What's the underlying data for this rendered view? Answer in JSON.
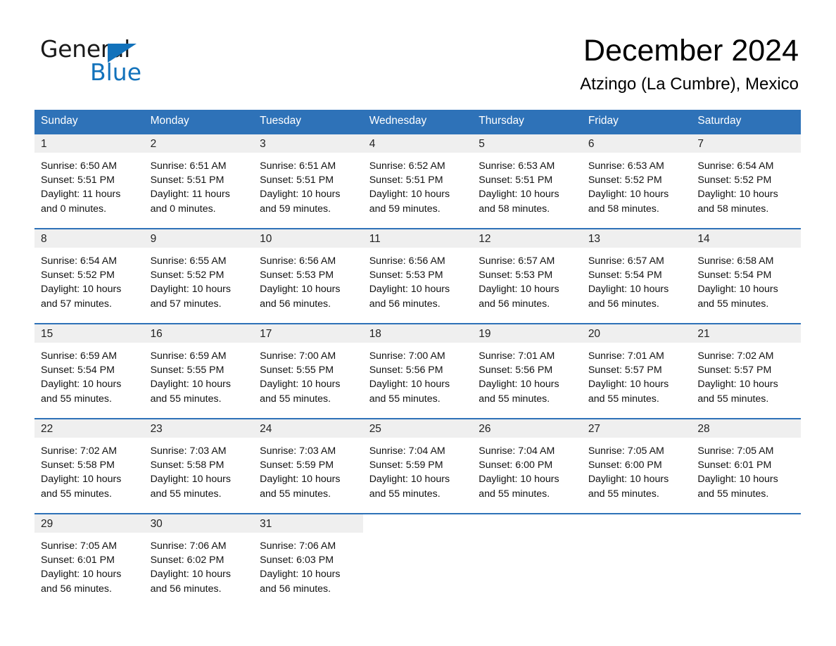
{
  "logo": {
    "primary": "General",
    "secondary": "Blue",
    "triangle_color": "#1272bb"
  },
  "header": {
    "title": "December 2024",
    "subtitle": "Atzingo (La Cumbre), Mexico"
  },
  "theme": {
    "header_blue": "#2E72B8",
    "daynum_band": "#EFEFEF",
    "text": "#000000"
  },
  "weekdays": [
    "Sunday",
    "Monday",
    "Tuesday",
    "Wednesday",
    "Thursday",
    "Friday",
    "Saturday"
  ],
  "weeks": [
    [
      {
        "day": "1",
        "sunrise": "Sunrise: 6:50 AM",
        "sunset": "Sunset: 5:51 PM",
        "daylight": "Daylight: 11 hours and 0 minutes."
      },
      {
        "day": "2",
        "sunrise": "Sunrise: 6:51 AM",
        "sunset": "Sunset: 5:51 PM",
        "daylight": "Daylight: 11 hours and 0 minutes."
      },
      {
        "day": "3",
        "sunrise": "Sunrise: 6:51 AM",
        "sunset": "Sunset: 5:51 PM",
        "daylight": "Daylight: 10 hours and 59 minutes."
      },
      {
        "day": "4",
        "sunrise": "Sunrise: 6:52 AM",
        "sunset": "Sunset: 5:51 PM",
        "daylight": "Daylight: 10 hours and 59 minutes."
      },
      {
        "day": "5",
        "sunrise": "Sunrise: 6:53 AM",
        "sunset": "Sunset: 5:51 PM",
        "daylight": "Daylight: 10 hours and 58 minutes."
      },
      {
        "day": "6",
        "sunrise": "Sunrise: 6:53 AM",
        "sunset": "Sunset: 5:52 PM",
        "daylight": "Daylight: 10 hours and 58 minutes."
      },
      {
        "day": "7",
        "sunrise": "Sunrise: 6:54 AM",
        "sunset": "Sunset: 5:52 PM",
        "daylight": "Daylight: 10 hours and 58 minutes."
      }
    ],
    [
      {
        "day": "8",
        "sunrise": "Sunrise: 6:54 AM",
        "sunset": "Sunset: 5:52 PM",
        "daylight": "Daylight: 10 hours and 57 minutes."
      },
      {
        "day": "9",
        "sunrise": "Sunrise: 6:55 AM",
        "sunset": "Sunset: 5:52 PM",
        "daylight": "Daylight: 10 hours and 57 minutes."
      },
      {
        "day": "10",
        "sunrise": "Sunrise: 6:56 AM",
        "sunset": "Sunset: 5:53 PM",
        "daylight": "Daylight: 10 hours and 56 minutes."
      },
      {
        "day": "11",
        "sunrise": "Sunrise: 6:56 AM",
        "sunset": "Sunset: 5:53 PM",
        "daylight": "Daylight: 10 hours and 56 minutes."
      },
      {
        "day": "12",
        "sunrise": "Sunrise: 6:57 AM",
        "sunset": "Sunset: 5:53 PM",
        "daylight": "Daylight: 10 hours and 56 minutes."
      },
      {
        "day": "13",
        "sunrise": "Sunrise: 6:57 AM",
        "sunset": "Sunset: 5:54 PM",
        "daylight": "Daylight: 10 hours and 56 minutes."
      },
      {
        "day": "14",
        "sunrise": "Sunrise: 6:58 AM",
        "sunset": "Sunset: 5:54 PM",
        "daylight": "Daylight: 10 hours and 55 minutes."
      }
    ],
    [
      {
        "day": "15",
        "sunrise": "Sunrise: 6:59 AM",
        "sunset": "Sunset: 5:54 PM",
        "daylight": "Daylight: 10 hours and 55 minutes."
      },
      {
        "day": "16",
        "sunrise": "Sunrise: 6:59 AM",
        "sunset": "Sunset: 5:55 PM",
        "daylight": "Daylight: 10 hours and 55 minutes."
      },
      {
        "day": "17",
        "sunrise": "Sunrise: 7:00 AM",
        "sunset": "Sunset: 5:55 PM",
        "daylight": "Daylight: 10 hours and 55 minutes."
      },
      {
        "day": "18",
        "sunrise": "Sunrise: 7:00 AM",
        "sunset": "Sunset: 5:56 PM",
        "daylight": "Daylight: 10 hours and 55 minutes."
      },
      {
        "day": "19",
        "sunrise": "Sunrise: 7:01 AM",
        "sunset": "Sunset: 5:56 PM",
        "daylight": "Daylight: 10 hours and 55 minutes."
      },
      {
        "day": "20",
        "sunrise": "Sunrise: 7:01 AM",
        "sunset": "Sunset: 5:57 PM",
        "daylight": "Daylight: 10 hours and 55 minutes."
      },
      {
        "day": "21",
        "sunrise": "Sunrise: 7:02 AM",
        "sunset": "Sunset: 5:57 PM",
        "daylight": "Daylight: 10 hours and 55 minutes."
      }
    ],
    [
      {
        "day": "22",
        "sunrise": "Sunrise: 7:02 AM",
        "sunset": "Sunset: 5:58 PM",
        "daylight": "Daylight: 10 hours and 55 minutes."
      },
      {
        "day": "23",
        "sunrise": "Sunrise: 7:03 AM",
        "sunset": "Sunset: 5:58 PM",
        "daylight": "Daylight: 10 hours and 55 minutes."
      },
      {
        "day": "24",
        "sunrise": "Sunrise: 7:03 AM",
        "sunset": "Sunset: 5:59 PM",
        "daylight": "Daylight: 10 hours and 55 minutes."
      },
      {
        "day": "25",
        "sunrise": "Sunrise: 7:04 AM",
        "sunset": "Sunset: 5:59 PM",
        "daylight": "Daylight: 10 hours and 55 minutes."
      },
      {
        "day": "26",
        "sunrise": "Sunrise: 7:04 AM",
        "sunset": "Sunset: 6:00 PM",
        "daylight": "Daylight: 10 hours and 55 minutes."
      },
      {
        "day": "27",
        "sunrise": "Sunrise: 7:05 AM",
        "sunset": "Sunset: 6:00 PM",
        "daylight": "Daylight: 10 hours and 55 minutes."
      },
      {
        "day": "28",
        "sunrise": "Sunrise: 7:05 AM",
        "sunset": "Sunset: 6:01 PM",
        "daylight": "Daylight: 10 hours and 55 minutes."
      }
    ],
    [
      {
        "day": "29",
        "sunrise": "Sunrise: 7:05 AM",
        "sunset": "Sunset: 6:01 PM",
        "daylight": "Daylight: 10 hours and 56 minutes."
      },
      {
        "day": "30",
        "sunrise": "Sunrise: 7:06 AM",
        "sunset": "Sunset: 6:02 PM",
        "daylight": "Daylight: 10 hours and 56 minutes."
      },
      {
        "day": "31",
        "sunrise": "Sunrise: 7:06 AM",
        "sunset": "Sunset: 6:03 PM",
        "daylight": "Daylight: 10 hours and 56 minutes."
      },
      {
        "day": "",
        "sunrise": "",
        "sunset": "",
        "daylight": ""
      },
      {
        "day": "",
        "sunrise": "",
        "sunset": "",
        "daylight": ""
      },
      {
        "day": "",
        "sunrise": "",
        "sunset": "",
        "daylight": ""
      },
      {
        "day": "",
        "sunrise": "",
        "sunset": "",
        "daylight": ""
      }
    ]
  ]
}
